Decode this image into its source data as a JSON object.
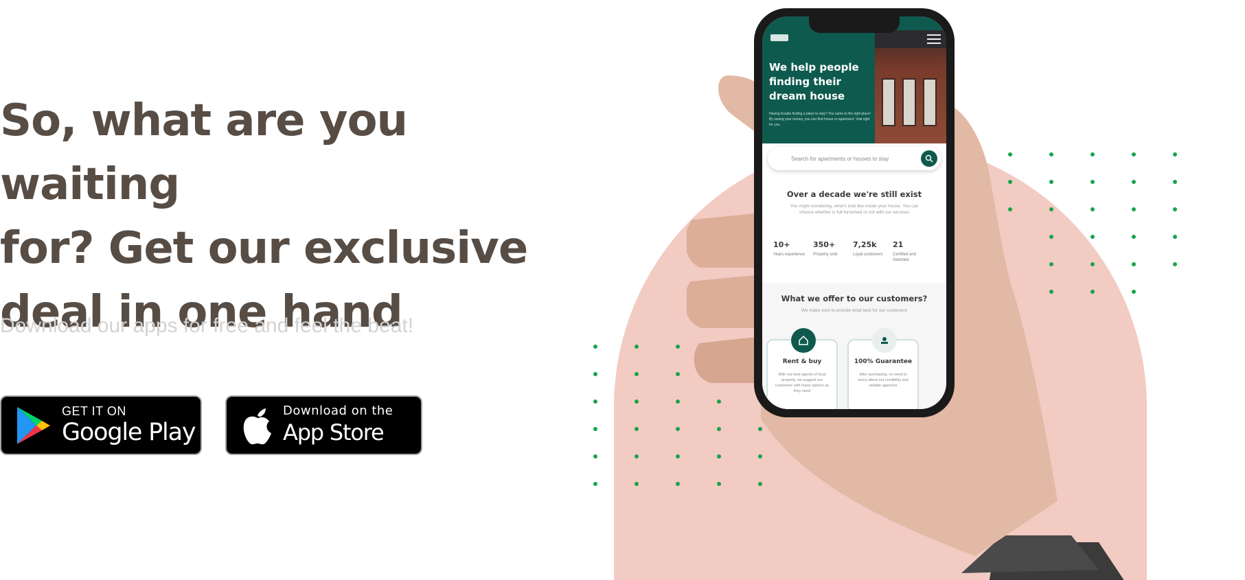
{
  "hero": {
    "headline_line1": "So, what are you waiting",
    "headline_line2": "for? Get our exclusive",
    "headline_line3": "deal in one hand",
    "subtext": "Download our apps for free and feel the beat!"
  },
  "google_play": {
    "small_label": "GET IT ON",
    "big_label": "Google Play",
    "icon": "google-play-icon"
  },
  "app_store": {
    "small_label": "Download on the",
    "big_label": "App Store",
    "icon": "apple-icon"
  },
  "phone_screen": {
    "hero_title": "We help people finding their dream house",
    "hero_desc": "Having trouble finding a place to stay? You came to the right place! By saving your money, you can find house or apartment. Visit right for you.",
    "search_placeholder": "Search for apartments or houses to stay",
    "section1_title": "Over a decade we're still exist",
    "section1_desc": "You might wondering, what's look like inside your house. You can choose whether is full-furnished or not with our services",
    "stats": [
      {
        "value": "10+",
        "label": "Years experience"
      },
      {
        "value": "350+",
        "label": "Property sold"
      },
      {
        "value": "7,25k",
        "label": "Loyal customers"
      },
      {
        "value": "21",
        "label": "Certified and Awarded"
      }
    ],
    "section2_title": "What we offer to our customers?",
    "section2_desc": "We make sure to provide what best for our customers",
    "cards": [
      {
        "title": "Rent & buy",
        "desc": "With our best agents of local property, we suggest our customers with many options as they need",
        "icon": "house-icon"
      },
      {
        "title": "100% Guarantee",
        "desc": "After purchasing, no need to worry about our credibility and reliable agencies",
        "icon": "handshake-icon"
      }
    ]
  },
  "colors": {
    "headline": "#574d45",
    "subtext": "#d3d3d3",
    "arch": "#f2cbc3",
    "dots": "#1aa34a",
    "brand_green": "#0f5a4e"
  }
}
